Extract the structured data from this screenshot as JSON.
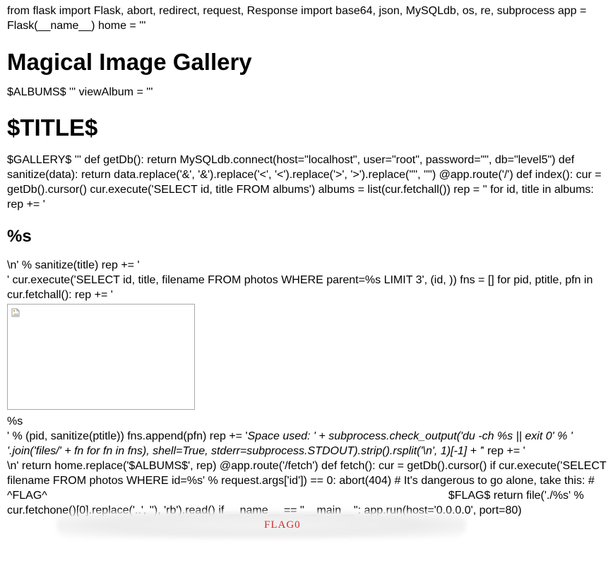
{
  "lines": {
    "l1": "from flask import Flask, abort, redirect, request, Response import base64, json, MySQLdb, os, re, subprocess app = Flask(__name__) home = '''",
    "h_gallery": "Magical Image Gallery",
    "l2": "$ALBUMS$ ''' viewAlbum = '''",
    "h_title": "$TITLE$",
    "l3": "$GALLERY$ ''' def getDb(): return MySQLdb.connect(host=\"localhost\", user=\"root\", password=\"\", db=\"level5\") def sanitize(data): return data.replace('&', '&').replace('<', '<').replace('>', '>').replace('\"', '\"') @app.route('/') def index(): cur = getDb().cursor() cur.execute('SELECT id, title FROM albums') albums = list(cur.fetchall()) rep = '' for id, title in albums: rep += '",
    "h_s": "%s",
    "l4": "\\n' % sanitize(title) rep += '",
    "l5": "' cur.execute('SELECT id, title, filename FROM photos WHERE parent=%s LIMIT 3', (id, )) fns = [] for pid, ptitle, pfn in cur.fetchall(): rep += '",
    "l6": "%s",
    "l7a": "' % (pid, sanitize(ptitle)) fns.append(pfn) rep += '",
    "l7b": "Space used: ' + subprocess.check_output('du -ch %s || exit 0' % ' '.join('files/' + fn for fn in fns), shell=True, stderr=subprocess.STDOUT).strip().rsplit('\\n', 1)[-1] + '",
    "l7c": "' rep += '",
    "l8": "\\n' return home.replace('$ALBUMS$', rep) @app.route('/fetch') def fetch(): cur = getDb().cursor() if cur.execute('SELECT filename FROM photos WHERE id=%s' % request.args['id']) == 0: abort(404) # It's dangerous to go alone, take this: #",
    "l9a": "^FLAG^",
    "l9b": "$FLAG$ return file('./%s' % cur.fetchone()[0].replace('..', ''), 'rb').read() if __name__ == \"__main__\": app.run(host='0.0.0.0', port=80)"
  },
  "redaction": {
    "label": "FLAG0"
  },
  "icons": {
    "broken_image": "broken-image-icon"
  }
}
